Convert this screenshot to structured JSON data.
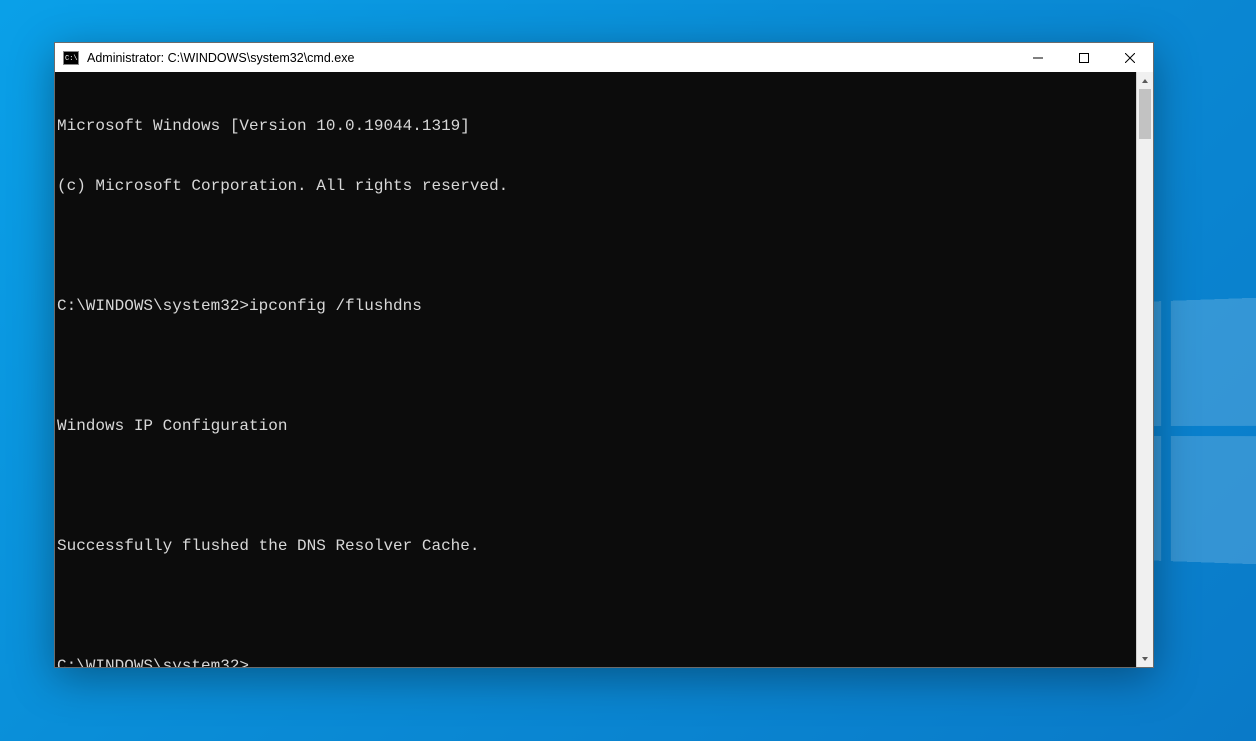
{
  "window": {
    "title": "Administrator: C:\\WINDOWS\\system32\\cmd.exe"
  },
  "terminal": {
    "lines": [
      "Microsoft Windows [Version 10.0.19044.1319]",
      "(c) Microsoft Corporation. All rights reserved.",
      "",
      "C:\\WINDOWS\\system32>ipconfig /flushdns",
      "",
      "Windows IP Configuration",
      "",
      "Successfully flushed the DNS Resolver Cache.",
      "",
      "C:\\WINDOWS\\system32>"
    ]
  }
}
